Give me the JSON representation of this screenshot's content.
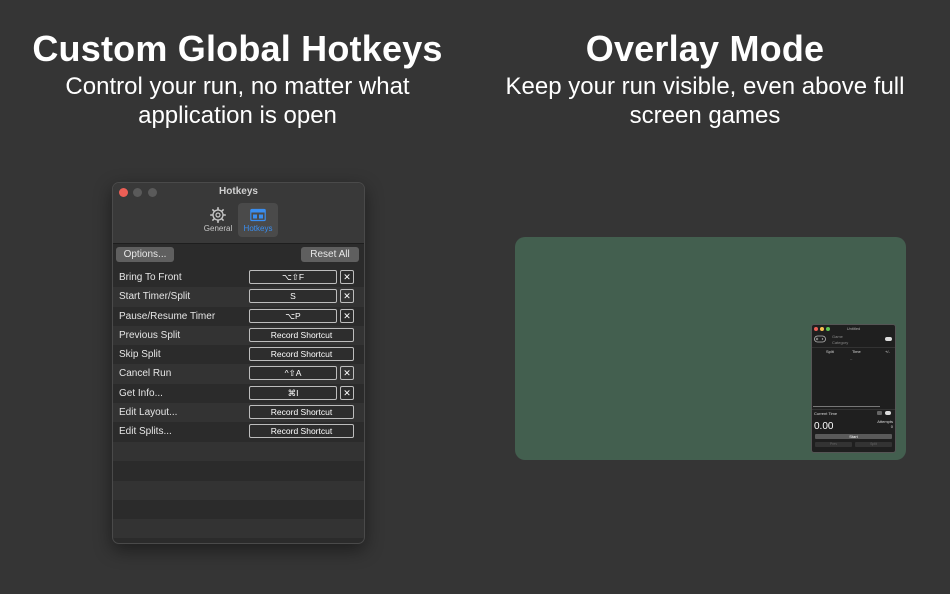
{
  "left_panel": {
    "title": "Custom Global Hotkeys",
    "subtitle": "Control your run, no matter what application is open"
  },
  "right_panel": {
    "title": "Overlay Mode",
    "subtitle": "Keep your run visible, even above full screen games"
  },
  "hotkeys_window": {
    "title": "Hotkeys",
    "tabs": [
      {
        "label": "General",
        "icon": "gear-icon",
        "selected": false
      },
      {
        "label": "Hotkeys",
        "icon": "keyboard-icon",
        "selected": true
      }
    ],
    "options_label": "Options...",
    "reset_label": "Reset All",
    "rows": [
      {
        "action": "Bring To Front",
        "shortcut": "⌥⇧F"
      },
      {
        "action": "Start Timer/Split",
        "shortcut": "S"
      },
      {
        "action": "Pause/Resume Timer",
        "shortcut": "⌥P"
      },
      {
        "action": "Previous Split",
        "shortcut": "Record Shortcut"
      },
      {
        "action": "Skip Split",
        "shortcut": "Record Shortcut"
      },
      {
        "action": "Cancel Run",
        "shortcut": "^⇧A"
      },
      {
        "action": "Get Info...",
        "shortcut": "⌘I"
      },
      {
        "action": "Edit Layout...",
        "shortcut": "Record Shortcut"
      },
      {
        "action": "Edit Splits...",
        "shortcut": "Record Shortcut"
      }
    ],
    "clear_glyph": "✕"
  },
  "overlay_window": {
    "title": "Untitled",
    "game_label": "Game",
    "category_label": "Category",
    "col_split": "Split",
    "col_time": "Time",
    "col_delta": "+/-",
    "placeholder": "–",
    "current_time_label": "Current Time",
    "attempts_label": "Attempts",
    "attempts_value": "0",
    "time_value": "0.00",
    "start_label": "Start",
    "prev_label": "Prev",
    "split_label": "Split"
  },
  "colors": {
    "background": "#353535",
    "overlay_green": "#435f4f",
    "accent_blue": "#3a8ef0",
    "close_red": "#ec5f56"
  }
}
